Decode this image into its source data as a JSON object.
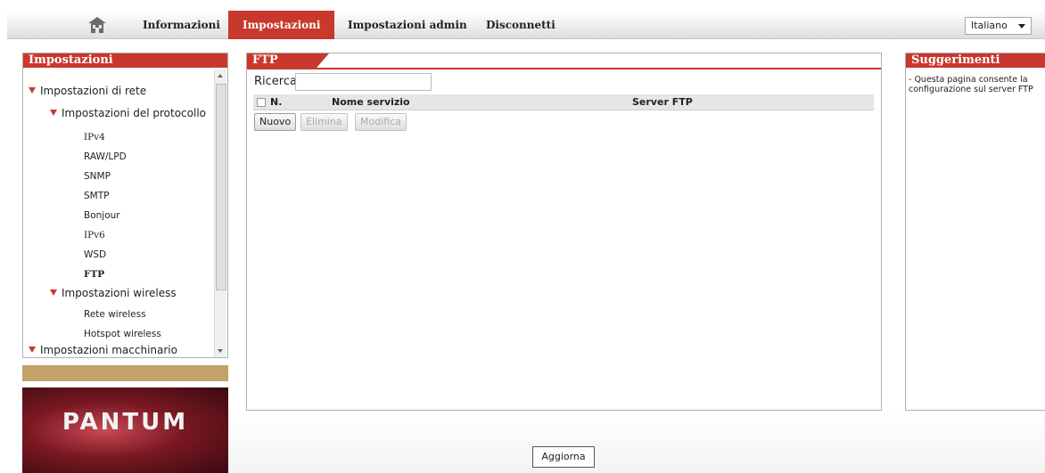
{
  "nav": {
    "home_icon": "home-icon",
    "items": [
      "Informazioni",
      "Impostazioni",
      "Impostazioni admin",
      "Disconnetti"
    ],
    "active": "Impostazioni",
    "language": "Italiano"
  },
  "sidebar": {
    "title": "Impostazioni",
    "tree": {
      "network": "Impostazioni di rete",
      "protocol": "Impostazioni del protocollo",
      "protocol_items": [
        "IPv4",
        "RAW/LPD",
        "SNMP",
        "SMTP",
        "Bonjour",
        "IPv6",
        "WSD",
        "FTP"
      ],
      "selected": "FTP",
      "wireless": "Impostazioni wireless",
      "wireless_items": [
        "Rete wireless",
        "Hotspot wireless"
      ],
      "machine": "Impostazioni macchinario"
    },
    "logo_text": "PANTUM"
  },
  "main": {
    "title": "FTP",
    "search_label": "Ricerca",
    "search_value": "",
    "columns": [
      "N.",
      "Nome servizio",
      "Server FTP"
    ],
    "buttons": {
      "new": "Nuovo",
      "delete": "Elimina",
      "edit": "Modifica"
    }
  },
  "tips": {
    "title": "Suggerimenti",
    "text": "- Questa pagina consente la configurazione sul server FTP"
  },
  "footer": {
    "refresh": "Aggiorna"
  },
  "colors": {
    "accent": "#c8382d",
    "tree_triangle": "#c8382d",
    "banner_strip": "#c3a36a"
  }
}
